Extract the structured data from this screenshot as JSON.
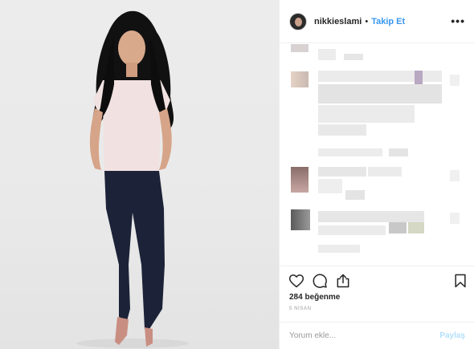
{
  "post": {
    "username": "nikkieslami",
    "separator": "•",
    "follow_label": "Takip Et",
    "more_label": "•••"
  },
  "actions": {
    "like_icon": "heart-icon",
    "comment_icon": "comment-icon",
    "share_icon": "share-icon",
    "save_icon": "bookmark-icon",
    "likes_text": "284 beğenme",
    "date_text": "5 NİSAN"
  },
  "comment_box": {
    "placeholder": "Yorum ekle...",
    "post_label": "Paylaş"
  },
  "colors": {
    "accent": "#3897f0",
    "post_disabled": "#b2dffc"
  }
}
